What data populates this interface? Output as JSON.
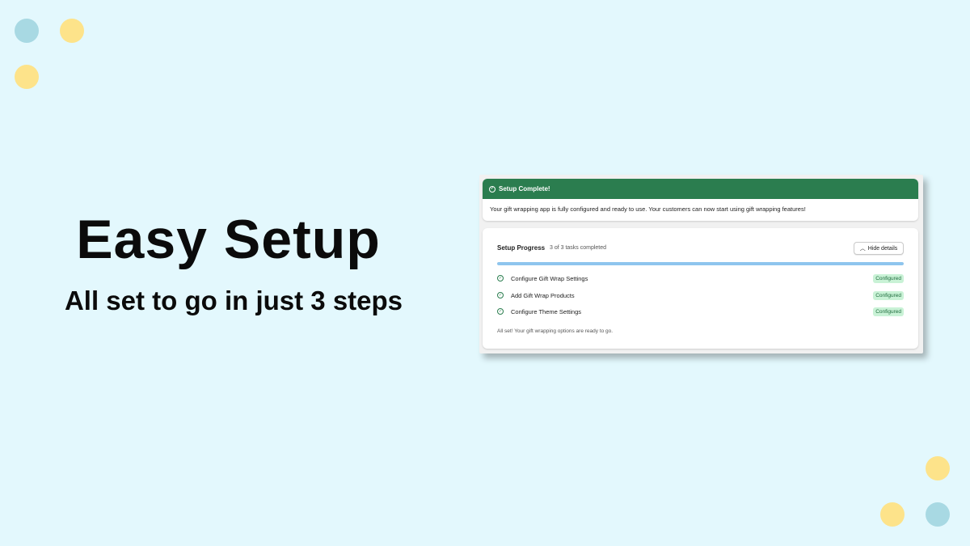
{
  "hero": {
    "title": "Easy Setup",
    "subtitle": "All set to go in just 3 steps"
  },
  "banner": {
    "title": "Setup Complete!",
    "message": "Your gift wrapping app is fully configured and ready to use. Your customers can now start using gift wrapping features!",
    "icon": "check-circle-icon",
    "color": "#2b7d4f"
  },
  "progress_card": {
    "title": "Setup Progress",
    "count": "3 of 3 tasks completed",
    "hide_button": "Hide details",
    "progress_fraction": 1.0,
    "tasks": [
      {
        "label": "Configure Gift Wrap Settings",
        "status": "Configured"
      },
      {
        "label": "Add Gift Wrap Products",
        "status": "Configured"
      },
      {
        "label": "Configure Theme Settings",
        "status": "Configured"
      }
    ],
    "footer": "All set! Your gift wrapping options are ready to go."
  },
  "colors": {
    "background": "#e3f8fd",
    "dot_blue": "#a8d9e3",
    "dot_yellow": "#fde38a",
    "progress": "#8ec5ee",
    "badge_bg": "#c9f2d6"
  }
}
